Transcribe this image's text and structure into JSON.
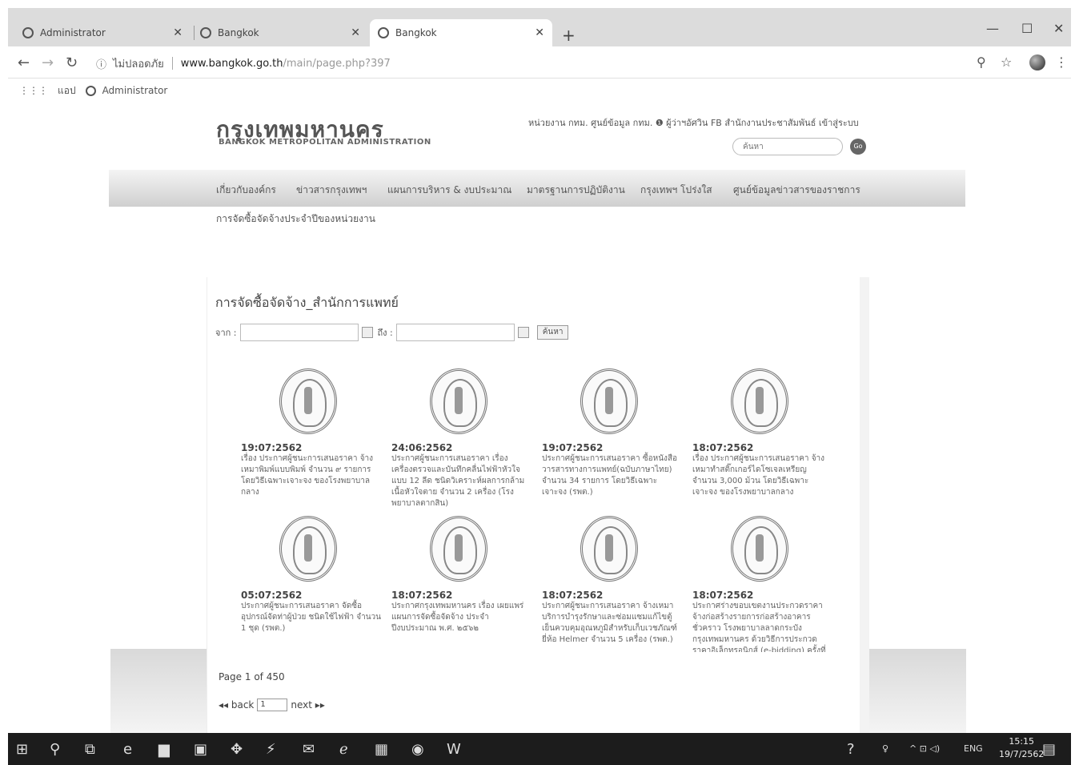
{
  "browser": {
    "tabs": [
      {
        "label": "Administrator"
      },
      {
        "label": "Bangkok"
      },
      {
        "label": "Bangkok"
      }
    ],
    "url_security": "ไม่ปลอดภัย",
    "url_host": "www.bangkok.go.th",
    "url_path": "/main/page.php?397",
    "bookmarks": {
      "apps": "แอป",
      "admin": "Administrator"
    }
  },
  "site": {
    "logo_th": "กรุงเทพมหานคร",
    "logo_en": "BANGKOK METROPOLITAN ADMINISTRATION",
    "top_links": "หน่วยงาน กทม.  ศูนย์ข้อมูล กทม.  ❶ ผู้ว่าฯอัศวิน  FB สำนักงานประชาสัมพันธ์  เข้าสู่ระบบ",
    "search_placeholder": "ค้นหา",
    "go_label": "Go",
    "menu": [
      "เกี่ยวกับองค์กร",
      "ข่าวสารกรุงเทพฯ",
      "แผนการบริหาร & งบประมาณ",
      "มาตรฐานการปฏิบัติงาน",
      "กรุงเทพฯ โปร่งใส",
      "ศูนย์ข้อมูลข่าวสารของราชการ"
    ],
    "submenu": "การจัดซื้อจัดจ้างประจำปีของหน่วยงาน"
  },
  "panel": {
    "title": "การจัดซื้อจัดจ้าง_สำนักการแพทย์",
    "from_label": "จาก :",
    "to_label": "ถึง :",
    "search_btn": "ค้นหา",
    "items": [
      {
        "date": "19:07:2562",
        "desc": "เรื่อง ประกาศผู้ชนะการเสนอราคา จ้างเหมาพิมพ์แบบพิมพ์ จำนวน ๙ รายการ โดยวิธีเฉพาะเจาะจง ของโรงพยาบาลกลาง"
      },
      {
        "date": "24:06:2562",
        "desc": "ประกาศผู้ชนะการเสนอราคา เรื่อง เครื่องตรวจและบันทึกคลื่นไฟฟ้าหัวใจ แบบ 12 ลีด ชนิดวิเคราะห์ผลการกล้ามเนื้อหัวใจตาย จำนวน 2 เครื่อง (โรงพยาบาลตากสิน)"
      },
      {
        "date": "19:07:2562",
        "desc": "ประกาศผู้ชนะการเสนอราคา ซื้อหนังสือวารสารทางการแพทย์(ฉบับภาษาไทย) จำนวน 34 รายการ โดยวิธีเฉพาะเจาะจง (รพต.)"
      },
      {
        "date": "18:07:2562",
        "desc": "เรื่อง ประกาศผู้ชนะการเสนอราคา จ้างเหมาทำสติ๊กเกอร์ไดโซเจลเหรียญ จำนวน 3,000 ม้วน โดยวิธีเฉพาะเจาะจง ของโรงพยาบาลกลาง"
      },
      {
        "date": "05:07:2562",
        "desc": "ประกาศผู้ชนะการเสนอราคา จัดซื้ออุปกรณ์จัดท่าผู้ป่วย ชนิดใช้ไฟฟ้า จำนวน 1 ชุด (รพต.)"
      },
      {
        "date": "18:07:2562",
        "desc": "ประกาศกรุงเทพมหานคร เรื่อง เผยแพร่แผนการจัดซื้อจัดจ้าง ประจำปีงบประมาณ พ.ศ. ๒๕๖๒"
      },
      {
        "date": "18:07:2562",
        "desc": "ประกาศผู้ชนะการเสนอราคา จ้างเหมาบริการบำรุงรักษาและซ่อมแซมแก้ไขตู้เย็นควบคุมอุณหภูมิสำหรับเก็บเวชภัณฑ์ ยี่ห้อ Helmer จำนวน 5 เครื่อง (รพต.)"
      },
      {
        "date": "18:07:2562",
        "desc": "ประกาศร่างขอบเขตงานประกวดราคาจ้างก่อสร้างรายการก่อสร้างอาคารชั่วคราว โรงพยาบาลลาดกระบังกรุงเทพมหานคร ด้วยวิธีการประกวดราคาอิเล็กทรอนิกส์ (e-bidding) ครั้งที่"
      }
    ],
    "page_label": "Page  1  of  450",
    "back_label": "◂◂ back",
    "next_label": "next ▸▸",
    "page_select": "1"
  },
  "taskbar": {
    "lang": "ENG",
    "time": "15:15",
    "date": "19/7/2562"
  }
}
